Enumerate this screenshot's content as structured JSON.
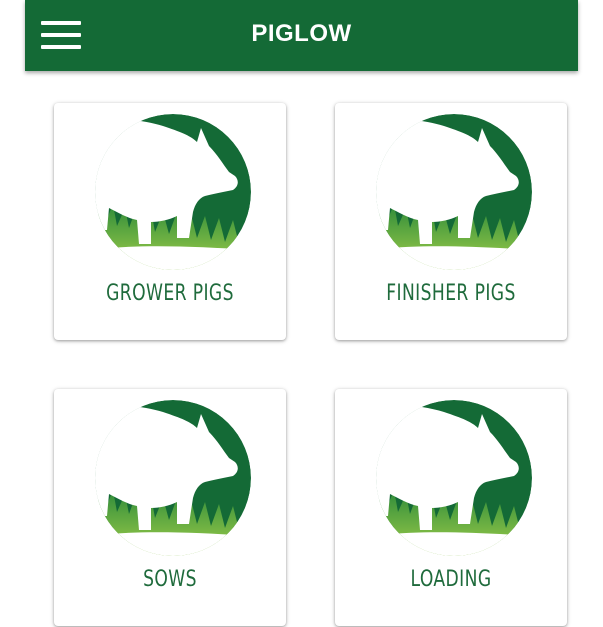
{
  "app_bar": {
    "title": "PIGLOW",
    "menu_icon": "hamburger-menu-icon",
    "background_color": "#146a36"
  },
  "cards": [
    {
      "label": "GROWER PIGS",
      "icon": "pig-logo-icon"
    },
    {
      "label": "FINISHER PIGS",
      "icon": "pig-logo-icon"
    },
    {
      "label": "SOWS",
      "icon": "pig-logo-icon"
    },
    {
      "label": "LOADING",
      "icon": "pig-logo-icon"
    }
  ],
  "colors": {
    "logo_dark_green": "#146a36",
    "grass_light_green": "#8dc63f",
    "label_green": "#1f6b3c"
  }
}
